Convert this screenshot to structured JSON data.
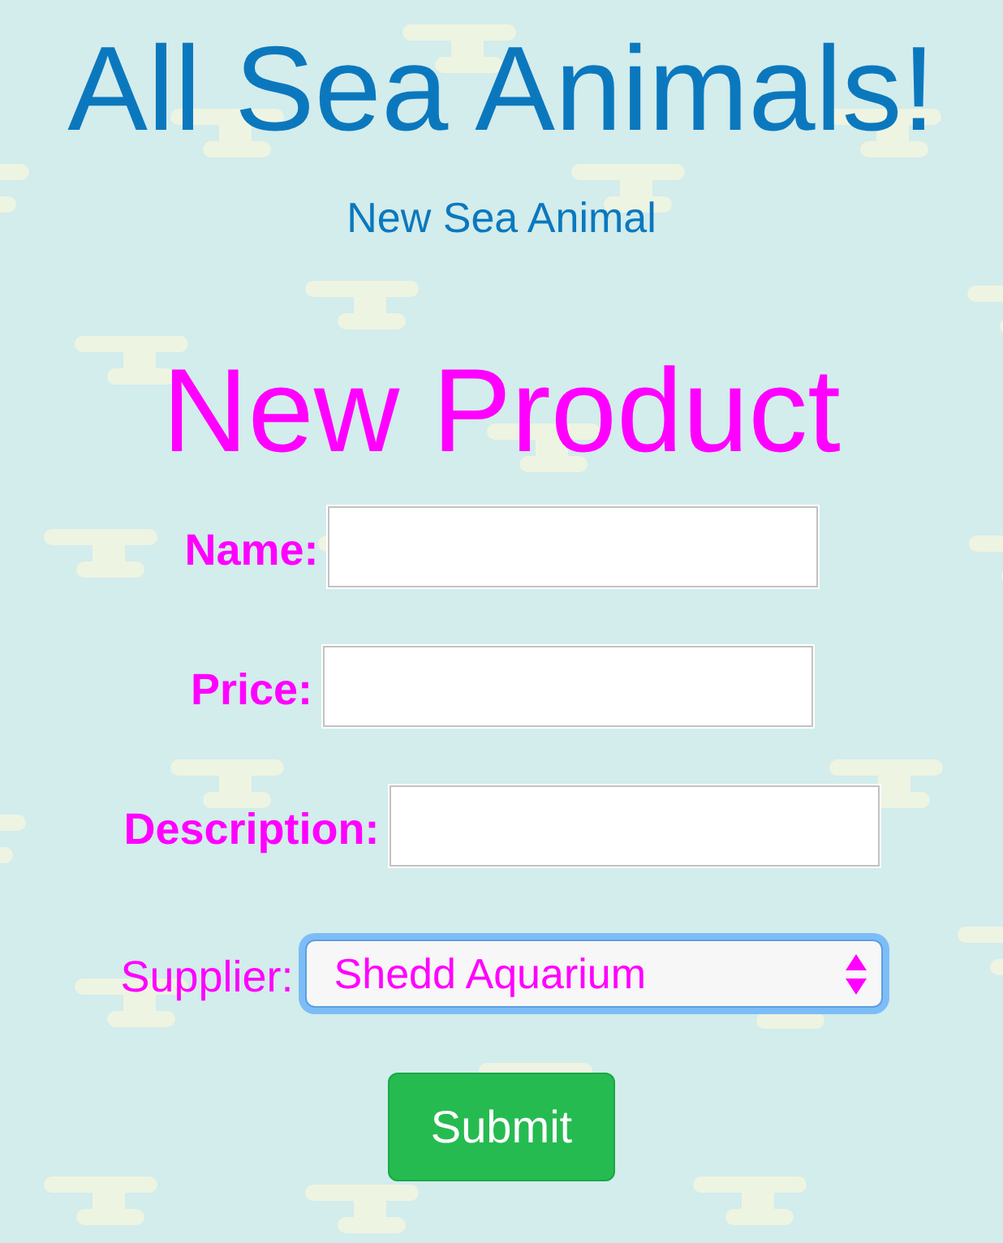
{
  "header": {
    "title": "All Sea Animals!",
    "link": "New Sea Animal"
  },
  "form": {
    "title": "New Product",
    "fields": [
      {
        "kind": "text",
        "label": "Name:"
      },
      {
        "kind": "text",
        "label": "Price:"
      },
      {
        "kind": "text",
        "label": "Description:"
      },
      {
        "kind": "select",
        "label": "Supplier:",
        "value": "Shedd Aquarium",
        "focused": true
      }
    ],
    "submit": "Submit"
  }
}
